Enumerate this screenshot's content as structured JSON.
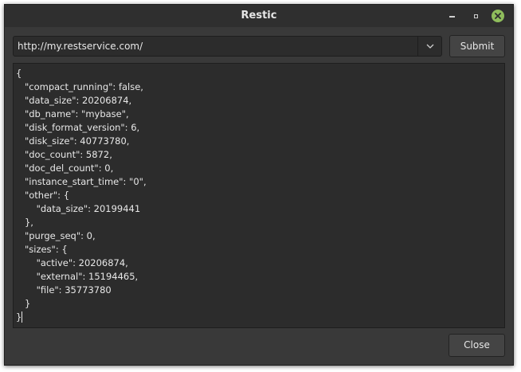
{
  "window": {
    "title": "Restic",
    "controls": {
      "minimize_icon": "minimize-icon",
      "restore_icon": "restore-icon",
      "close_icon": "close-icon",
      "close_color": "#8fbd5c"
    }
  },
  "url_combo": {
    "value": "http://my.restservice.com/",
    "arrow_icon": "chevron-down-icon"
  },
  "submit_label": "Submit",
  "response_lines": [
    "{",
    "   \"compact_running\": false,",
    "   \"data_size\": 20206874,",
    "   \"db_name\": \"mybase\",",
    "   \"disk_format_version\": 6,",
    "   \"disk_size\": 40773780,",
    "   \"doc_count\": 5872,",
    "   \"doc_del_count\": 0,",
    "   \"instance_start_time\": \"0\",",
    "   \"other\": {",
    "       \"data_size\": 20199441",
    "   },",
    "   \"purge_seq\": 0,",
    "   \"sizes\": {",
    "       \"active\": 20206874,",
    "       \"external\": 15194465,",
    "       \"file\": 35773780",
    "   }",
    "}"
  ],
  "close_label": "Close"
}
